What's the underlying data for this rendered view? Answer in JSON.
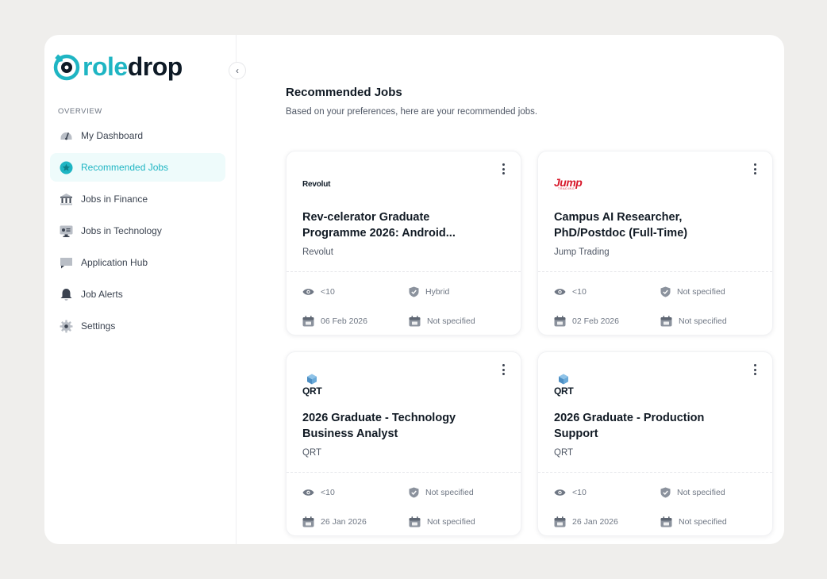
{
  "brand": {
    "logo_part1": "role",
    "logo_part2": "drop",
    "accent": "#1fb5c3"
  },
  "sidebar": {
    "section_label": "OVERVIEW",
    "items": [
      {
        "label": "My Dashboard",
        "icon": "gauge-icon",
        "active": false
      },
      {
        "label": "Recommended Jobs",
        "icon": "star-badge-icon",
        "active": true
      },
      {
        "label": "Jobs in Finance",
        "icon": "bank-icon",
        "active": false
      },
      {
        "label": "Jobs in Technology",
        "icon": "monitor-icon",
        "active": false
      },
      {
        "label": "Application Hub",
        "icon": "message-icon",
        "active": false
      },
      {
        "label": "Job Alerts",
        "icon": "bell-icon",
        "active": false
      },
      {
        "label": "Settings",
        "icon": "gear-icon",
        "active": false
      }
    ]
  },
  "main": {
    "title": "Recommended Jobs",
    "subtitle": "Based on your preferences, here are your recommended jobs."
  },
  "jobs": [
    {
      "logo": "Revolut",
      "title_line1": "Rev-celerator Graduate",
      "title_line2": "Programme 2026: Android...",
      "company": "Revolut",
      "applicants": "<10",
      "work_mode": "Hybrid",
      "posted": "06 Feb 2026",
      "deadline": "Not specified"
    },
    {
      "logo": "Jump",
      "logo_sub": "TRADING",
      "title_line1": "Campus AI Researcher,",
      "title_line2": "PhD/Postdoc (Full-Time)",
      "company": "Jump Trading",
      "applicants": "<10",
      "work_mode": "Not specified",
      "posted": "02 Feb 2026",
      "deadline": "Not specified"
    },
    {
      "logo": "QRT",
      "title_line1": "2026 Graduate - Technology",
      "title_line2": "Business Analyst",
      "company": "QRT",
      "applicants": "<10",
      "work_mode": "Not specified",
      "posted": "26 Jan 2026",
      "deadline": "Not specified"
    },
    {
      "logo": "QRT",
      "title_line1": "2026 Graduate - Production",
      "title_line2": "Support",
      "company": "QRT",
      "applicants": "<10",
      "work_mode": "Not specified",
      "posted": "26 Jan 2026",
      "deadline": "Not specified"
    }
  ]
}
